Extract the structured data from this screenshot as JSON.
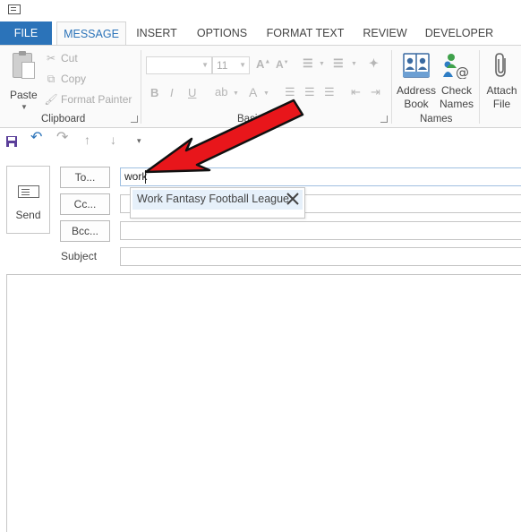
{
  "tabs": [
    "FILE",
    "MESSAGE",
    "INSERT",
    "OPTIONS",
    "FORMAT TEXT",
    "REVIEW",
    "DEVELOPER"
  ],
  "clipboard": {
    "paste": "Paste",
    "cut": "Cut",
    "copy": "Copy",
    "format_painter": "Format Painter",
    "group_label": "Clipboard"
  },
  "basic_text": {
    "font_size": "11",
    "group_label_partial": "Basi"
  },
  "names": {
    "address_book_line1": "Address",
    "address_book_line2": "Book",
    "check_names_line1": "Check",
    "check_names_line2": "Names",
    "group_label": "Names"
  },
  "include": {
    "attach_line1": "Attach",
    "attach_line2": "File"
  },
  "compose": {
    "send": "Send",
    "to_button": "To...",
    "cc_button": "Cc...",
    "bcc_button": "Bcc...",
    "subject_label": "Subject",
    "to_value": "work",
    "suggestion": "Work Fantasy Football League"
  },
  "icons": {
    "window": "outlook-window-icon",
    "save": "save-icon",
    "undo": "undo-icon",
    "redo": "redo-icon",
    "up": "arrow-up-icon",
    "down": "arrow-down-icon",
    "customize": "customize-qat-icon",
    "close": "close-icon"
  },
  "colors": {
    "accent": "#2b73b9",
    "annotation_arrow": "#e8161b"
  }
}
